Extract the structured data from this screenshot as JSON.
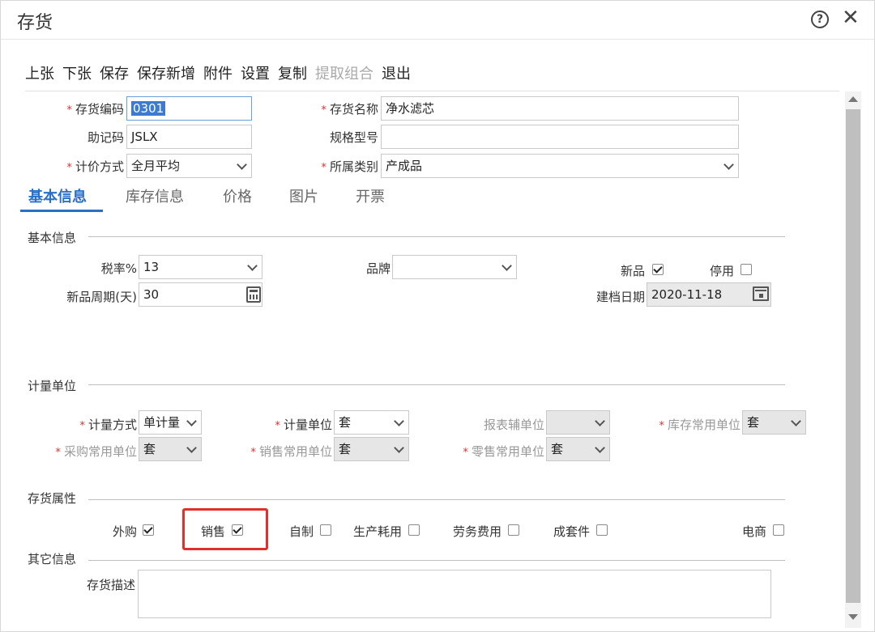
{
  "window": {
    "title": "存货"
  },
  "toolbar": {
    "items": [
      {
        "label": "上张",
        "disabled": false
      },
      {
        "label": "下张",
        "disabled": false
      },
      {
        "label": "保存",
        "disabled": false
      },
      {
        "label": "保存新增",
        "disabled": false
      },
      {
        "label": "附件",
        "disabled": false
      },
      {
        "label": "设置",
        "disabled": false
      },
      {
        "label": "复制",
        "disabled": false
      },
      {
        "label": "提取组合",
        "disabled": true
      },
      {
        "label": "退出",
        "disabled": false
      }
    ]
  },
  "header": {
    "code_label": "存货编码",
    "code_value": "0301",
    "name_label": "存货名称",
    "name_value": "净水滤芯",
    "mnemonic_label": "助记码",
    "mnemonic_value": "JSLX",
    "spec_label": "规格型号",
    "spec_value": "",
    "pricing_label": "计价方式",
    "pricing_value": "全月平均",
    "category_label": "所属类别",
    "category_value": "产成品",
    "required_mark": "*"
  },
  "tabs": [
    {
      "label": "基本信息",
      "active": true
    },
    {
      "label": "库存信息",
      "active": false
    },
    {
      "label": "价格",
      "active": false
    },
    {
      "label": "图片",
      "active": false
    },
    {
      "label": "开票",
      "active": false
    }
  ],
  "basic": {
    "section_title": "基本信息",
    "tax_label": "税率%",
    "tax_value": "13",
    "brand_label": "品牌",
    "brand_value": "",
    "newitem_label": "新品",
    "newitem_checked": true,
    "disabled_label": "停用",
    "disabled_checked": false,
    "cycle_label": "新品周期(天)",
    "cycle_value": "30",
    "createdate_label": "建档日期",
    "createdate_value": "2020-11-18"
  },
  "units": {
    "section_title": "计量单位",
    "method_label": "计量方式",
    "method_value": "单计量",
    "unit_label": "计量单位",
    "unit_value": "套",
    "report_label": "报表辅单位",
    "report_value": "",
    "stock_label": "库存常用单位",
    "stock_value": "套",
    "purchase_label": "采购常用单位",
    "purchase_value": "套",
    "sales_label": "销售常用单位",
    "sales_value": "套",
    "retail_label": "零售常用单位",
    "retail_value": "套"
  },
  "attributes": {
    "section_title": "存货属性",
    "items": [
      {
        "label": "外购",
        "checked": true
      },
      {
        "label": "销售",
        "checked": true
      },
      {
        "label": "自制",
        "checked": false
      },
      {
        "label": "生产耗用",
        "checked": false
      },
      {
        "label": "劳务费用",
        "checked": false
      },
      {
        "label": "成套件",
        "checked": false
      },
      {
        "label": "电商",
        "checked": false
      }
    ]
  },
  "other": {
    "section_title": "其它信息",
    "desc_label": "存货描述",
    "desc_value": ""
  },
  "colors": {
    "accent": "#2a6fc9",
    "required": "#e0302e",
    "highlight": "#e0302e"
  }
}
